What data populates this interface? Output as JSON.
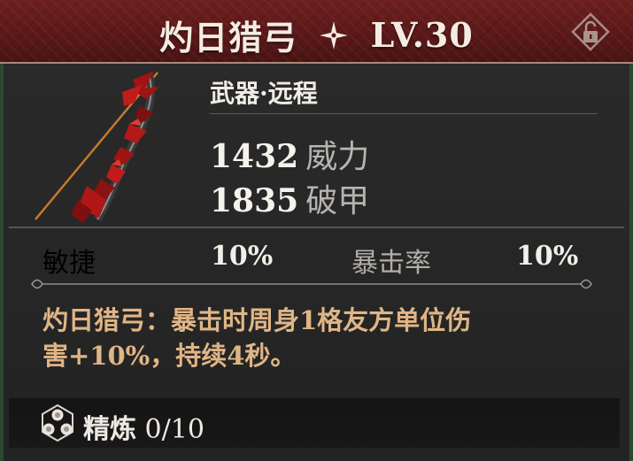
{
  "header": {
    "item_name": "灼日猎弓",
    "level": "LV.30",
    "star_icon": "four-point-star-icon",
    "lock_icon": "unlock-icon"
  },
  "weapon": {
    "icon": "crimson-bow-icon",
    "type": "武器·远程",
    "stats": [
      {
        "value": "1432",
        "label": "威力"
      },
      {
        "value": "1835",
        "label": "破甲"
      }
    ]
  },
  "attributes": [
    {
      "name": "敏捷",
      "value": "10%"
    },
    {
      "name": "暴击率",
      "value": "10%"
    }
  ],
  "description": {
    "line1": "灼日猎弓：暴击时周身1格友方单位伤",
    "line2": "害+10%，持续4秒。"
  },
  "refine": {
    "icon": "refine-hex-icon",
    "label": "精炼",
    "value": "0/10"
  },
  "colors": {
    "header_bg": "#5a1818",
    "accent_text": "#e0b586",
    "card_bg": "#272727"
  }
}
